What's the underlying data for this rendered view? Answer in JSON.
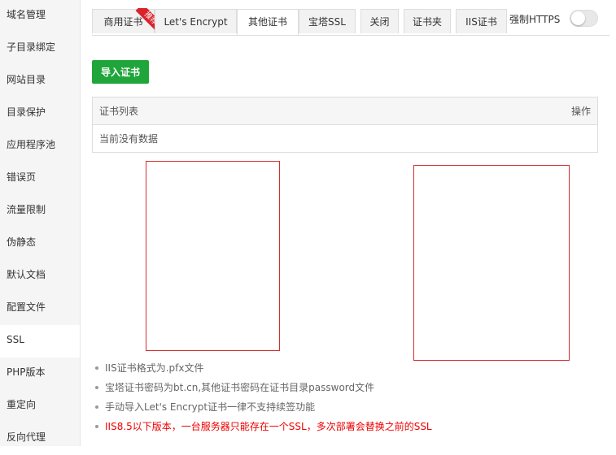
{
  "sidebar": {
    "items": [
      {
        "label": "域名管理"
      },
      {
        "label": "子目录绑定"
      },
      {
        "label": "网站目录"
      },
      {
        "label": "目录保护"
      },
      {
        "label": "应用程序池"
      },
      {
        "label": "错误页"
      },
      {
        "label": "流量限制"
      },
      {
        "label": "伪静态"
      },
      {
        "label": "默认文档"
      },
      {
        "label": "配置文件"
      },
      {
        "label": "SSL"
      },
      {
        "label": "PHP版本"
      },
      {
        "label": "重定向"
      },
      {
        "label": "反向代理"
      }
    ],
    "active": "SSL"
  },
  "tabs": [
    {
      "label": "商用证书",
      "badge": "推荐"
    },
    {
      "label": "Let's Encrypt"
    },
    {
      "label": "其他证书"
    },
    {
      "label": "宝塔SSL"
    },
    {
      "label": "关闭"
    },
    {
      "label": "证书夹"
    },
    {
      "label": "IIS证书"
    }
  ],
  "active_tab": "其他证书",
  "force_https": {
    "label": "强制HTTPS",
    "enabled": false
  },
  "import_button": "导入证书",
  "table": {
    "headers": {
      "list": "证书列表",
      "action": "操作"
    },
    "empty": "当前没有数据"
  },
  "notes": [
    {
      "text": "IIS证书格式为.pfx文件",
      "warn": false
    },
    {
      "text": "宝塔证书密码为bt.cn,其他证书密码在证书目录password文件",
      "warn": false
    },
    {
      "text": "手动导入Let's Encrypt证书一律不支持续签功能",
      "warn": false
    },
    {
      "text": "IIS8.5以下版本，一台服务器只能存在一个SSL，多次部署会替换之前的SSL",
      "warn": true
    }
  ],
  "colors": {
    "accent": "#20a53a",
    "warning": "#ee0000",
    "box_border": "#d32f2f"
  }
}
